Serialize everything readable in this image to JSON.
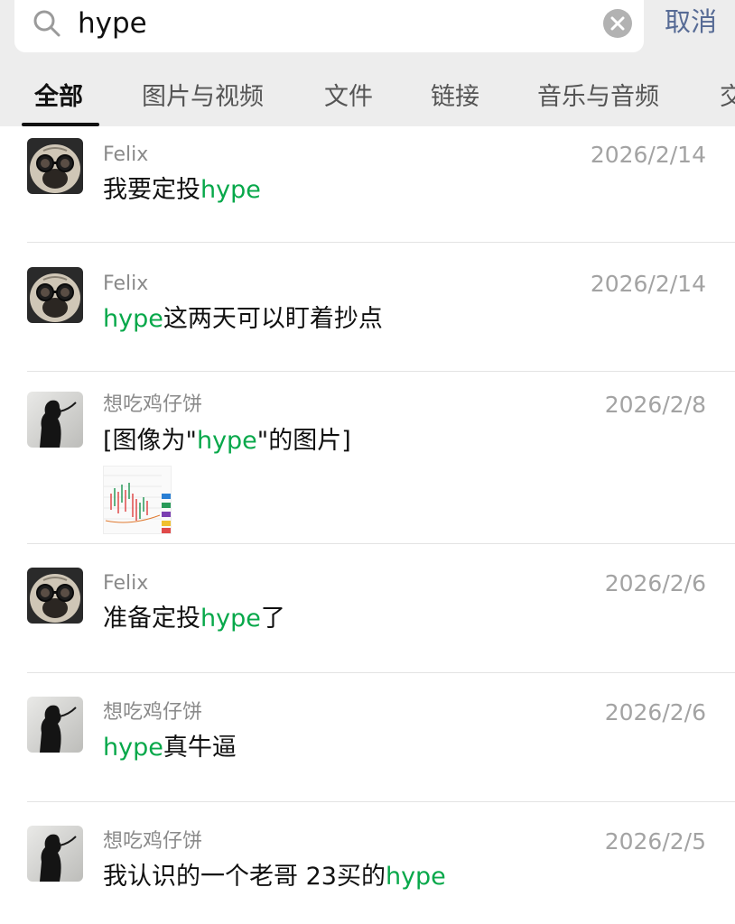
{
  "search": {
    "query": "hype",
    "cancel_label": "取消"
  },
  "tabs": [
    {
      "label": "全部",
      "active": true
    },
    {
      "label": "图片与视频",
      "active": false
    },
    {
      "label": "文件",
      "active": false
    },
    {
      "label": "链接",
      "active": false
    },
    {
      "label": "音乐与音频",
      "active": false
    },
    {
      "label": "交",
      "active": false
    }
  ],
  "highlight_color": "#07a84a",
  "results": [
    {
      "sender": "Felix",
      "date": "2026/2/14",
      "avatar": "pug-avatar",
      "before": "我要定投",
      "keyword": "hype",
      "after": ""
    },
    {
      "sender": "Felix",
      "date": "2026/2/14",
      "avatar": "pug-avatar",
      "before": "",
      "keyword": "hype",
      "after": "这两天可以盯着抄点"
    },
    {
      "sender": "想吃鸡仔饼",
      "date": "2026/2/8",
      "avatar": "silhouette-avatar",
      "before": "[图像为\"",
      "keyword": "hype",
      "after": "\"的图片]"
    },
    {
      "sender": "Felix",
      "date": "2026/2/6",
      "avatar": "pug-avatar",
      "before": "准备定投",
      "keyword": "hype",
      "after": "了"
    },
    {
      "sender": "想吃鸡仔饼",
      "date": "2026/2/6",
      "avatar": "silhouette-avatar",
      "before": "",
      "keyword": "hype",
      "after": "真牛逼"
    },
    {
      "sender": "想吃鸡仔饼",
      "date": "2026/2/5",
      "avatar": "silhouette-avatar",
      "before": "我认识的一个老哥 23买的",
      "keyword": "hype",
      "after": ""
    }
  ]
}
